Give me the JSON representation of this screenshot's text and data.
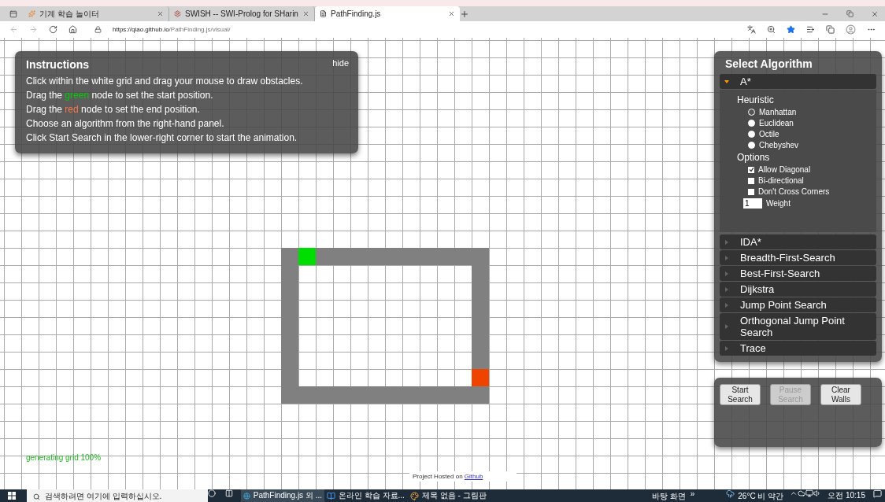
{
  "browser": {
    "tabs": [
      {
        "title": "기계 학습 놀이터",
        "selected": false
      },
      {
        "title": "SWISH -- SWI-Prolog for SHarin",
        "selected": false
      },
      {
        "title": "PathFinding.js",
        "selected": true
      }
    ],
    "url": {
      "host": "https://qiao.github.io",
      "path": "/PathFinding.js/visual/"
    }
  },
  "instructions": {
    "title": "Instructions",
    "hide": "hide",
    "lines": [
      [
        {
          "text": "Click within the white grid and drag your mouse to draw obstacles."
        }
      ],
      [
        {
          "text": "Drag the "
        },
        {
          "text": "green",
          "color": "#00cc00"
        },
        {
          "text": " node to set the start position."
        }
      ],
      [
        {
          "text": "Drag the "
        },
        {
          "text": "red",
          "color": "#ff7744"
        },
        {
          "text": " node to set the end position."
        }
      ],
      [
        {
          "text": "Choose an algorithm from the right-hand panel."
        }
      ],
      [
        {
          "text": "Click Start Search in the lower-right corner to start the animation."
        }
      ]
    ]
  },
  "algorithms": {
    "title": "Select Algorithm",
    "items": [
      {
        "name": "A*",
        "expanded": true,
        "heuristic_label": "Heuristic",
        "heuristics": [
          {
            "label": "Manhattan",
            "selected": true
          },
          {
            "label": "Euclidean",
            "selected": false
          },
          {
            "label": "Octile",
            "selected": false
          },
          {
            "label": "Chebyshev",
            "selected": false
          }
        ],
        "options_label": "Options",
        "options": [
          {
            "label": "Allow Diagonal",
            "checked": true
          },
          {
            "label": "Bi-directional",
            "checked": false
          },
          {
            "label": "Don't Cross Corners",
            "checked": false
          }
        ],
        "weight": {
          "value": "1",
          "label": "Weight"
        }
      },
      {
        "name": "IDA*",
        "expanded": false
      },
      {
        "name": "Breadth-First-Search",
        "expanded": false
      },
      {
        "name": "Best-First-Search",
        "expanded": false
      },
      {
        "name": "Dijkstra",
        "expanded": false
      },
      {
        "name": "Jump Point Search",
        "expanded": false
      },
      {
        "name": "Orthogonal Jump Point Search",
        "expanded": false
      },
      {
        "name": "Trace",
        "expanded": false
      }
    ]
  },
  "controls": [
    {
      "label": "Start Search",
      "disabled": false
    },
    {
      "label": "Pause Search",
      "disabled": true
    },
    {
      "label": "Clear Walls",
      "disabled": false
    }
  ],
  "status": "generating grid 100%",
  "footer": {
    "text": "Project Hosted on",
    "link": "Github"
  },
  "taskbar": {
    "search_placeholder": "검색하려면 여기에 입력하십시오.",
    "apps": [
      {
        "label": "PathFinding.js 외 ...",
        "selected": true
      },
      {
        "label": "온라인 학습 자료...",
        "selected": false
      },
      {
        "label": "제목 없음 - 그림판",
        "selected": false
      }
    ],
    "desktop": "바탕 화면",
    "more": "»",
    "weather": "26°C 비 약간",
    "time": "오전 10:15"
  }
}
